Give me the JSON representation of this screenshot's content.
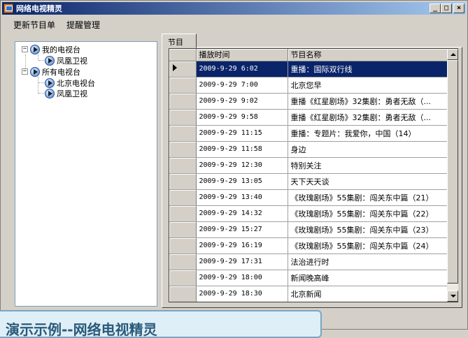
{
  "window": {
    "title": "网络电视精灵"
  },
  "title_buttons": {
    "minimize": "_",
    "maximize": "□",
    "close": "×"
  },
  "menu": {
    "items": [
      "更新节目单",
      "提醒管理"
    ]
  },
  "tree": {
    "nodes": [
      {
        "label": "我的电视台",
        "toggle": "−"
      },
      {
        "label": "凤凰卫视"
      },
      {
        "label": "所有电视台",
        "toggle": "−"
      },
      {
        "label": "北京电视台"
      },
      {
        "label": "凤凰卫视"
      }
    ]
  },
  "tabs": [
    {
      "label": "节目"
    }
  ],
  "grid": {
    "columns": [
      "播放时间",
      "节目名称"
    ],
    "selected_row": 0,
    "rows": [
      {
        "time": "2009-9-29 6:02",
        "name": "重播：国际双行线"
      },
      {
        "time": "2009-9-29 7:00",
        "name": "北京您早"
      },
      {
        "time": "2009-9-29 9:02",
        "name": "重播《红星剧场》32集剧：勇者无敌（..."
      },
      {
        "time": "2009-9-29 9:58",
        "name": "重播《红星剧场》32集剧：勇者无敌（..."
      },
      {
        "time": "2009-9-29 11:15",
        "name": "重播：专题片：我爱你，中国（14）"
      },
      {
        "time": "2009-9-29 11:58",
        "name": "身边"
      },
      {
        "time": "2009-9-29 12:30",
        "name": "特别关注"
      },
      {
        "time": "2009-9-29 13:05",
        "name": "天下天天谈"
      },
      {
        "time": "2009-9-29 13:40",
        "name": "《玫瑰剧场》55集剧：闯关东中篇（21）"
      },
      {
        "time": "2009-9-29 14:32",
        "name": "《玫瑰剧场》55集剧：闯关东中篇（22）"
      },
      {
        "time": "2009-9-29 15:27",
        "name": "《玫瑰剧场》55集剧：闯关东中篇（23）"
      },
      {
        "time": "2009-9-29 16:19",
        "name": "《玫瑰剧场》55集剧：闯关东中篇（24）"
      },
      {
        "time": "2009-9-29 17:31",
        "name": "法治进行时"
      },
      {
        "time": "2009-9-29 18:00",
        "name": "新闻晚高峰"
      },
      {
        "time": "2009-9-29 18:30",
        "name": "北京新闻"
      }
    ]
  },
  "caption": "演示示例--网络电视精灵",
  "colors": {
    "title_start": "#0a246a",
    "title_end": "#a6caf0",
    "selection": "#0a246a"
  }
}
